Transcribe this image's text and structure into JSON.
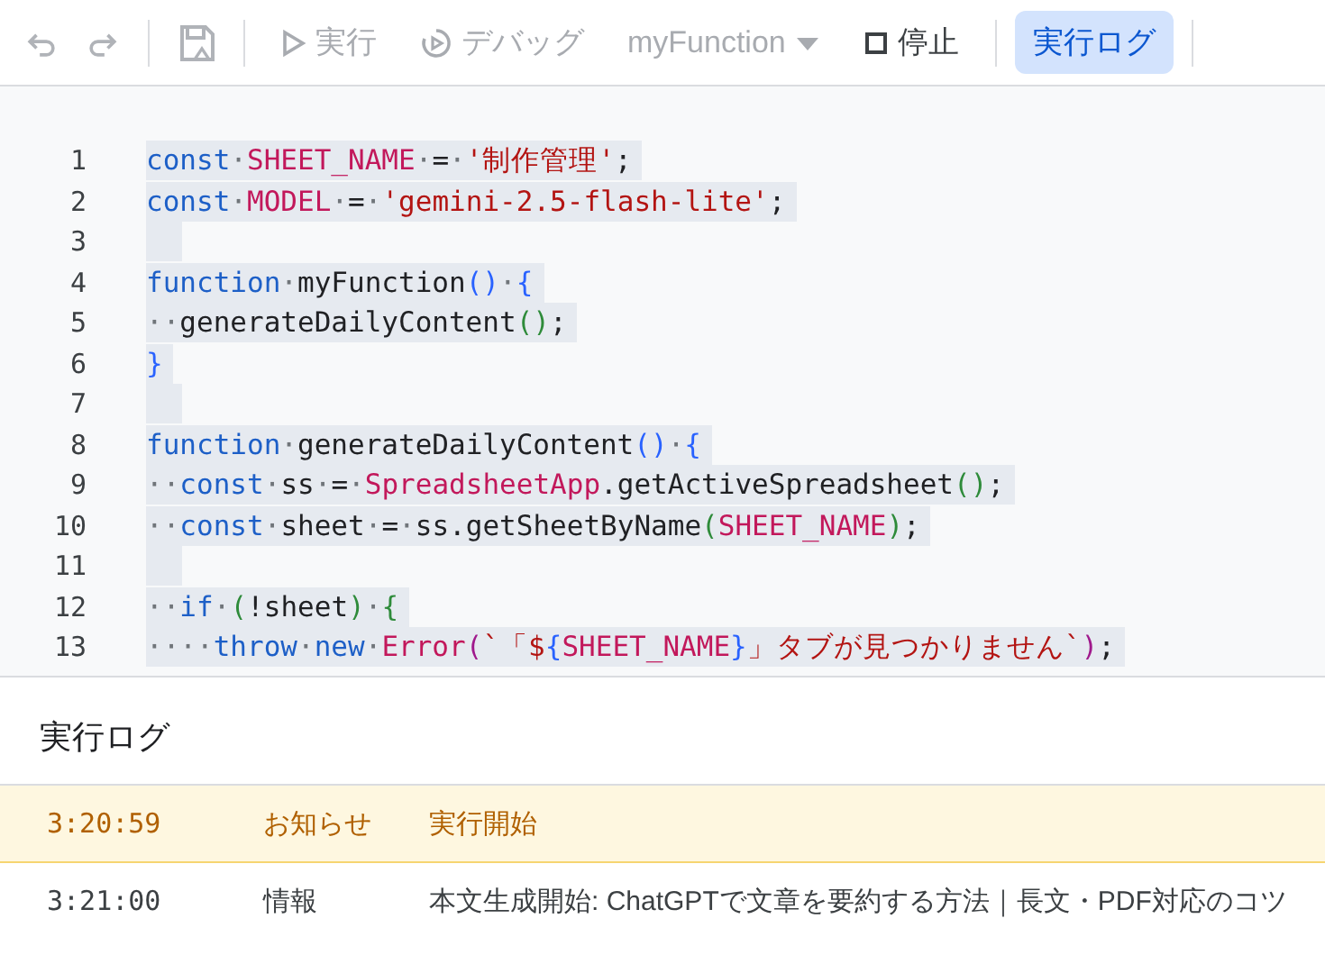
{
  "toolbar": {
    "items": [
      {
        "kind": "undo",
        "disabled": true
      },
      {
        "kind": "redo",
        "disabled": true
      },
      {
        "kind": "save",
        "disabled": true
      },
      {
        "kind": "run",
        "label": "実行",
        "disabled": true
      },
      {
        "kind": "debug",
        "label": "デバッグ",
        "disabled": true
      },
      {
        "kind": "dropdown",
        "label": "myFunction",
        "disabled": true
      },
      {
        "kind": "stop",
        "label": "停止",
        "disabled": false
      },
      {
        "kind": "toggle",
        "label": "実行ログ",
        "selected": true
      }
    ]
  },
  "editor": {
    "lines": [
      {
        "number": "1",
        "tokens": [
          {
            "text": "const",
            "kind": "kw"
          },
          {
            "text": "·",
            "kind": "ws"
          },
          {
            "text": "SHEET_NAME",
            "kind": "const"
          },
          {
            "text": "·",
            "kind": "ws"
          },
          {
            "text": "="
          },
          {
            "text": "·",
            "kind": "ws"
          },
          {
            "text": "'制作管理'",
            "kind": "str"
          },
          {
            "text": ";"
          }
        ]
      },
      {
        "number": "2",
        "tokens": [
          {
            "text": "const",
            "kind": "kw"
          },
          {
            "text": "·",
            "kind": "ws"
          },
          {
            "text": "MODEL",
            "kind": "const"
          },
          {
            "text": "·",
            "kind": "ws"
          },
          {
            "text": "="
          },
          {
            "text": "·",
            "kind": "ws"
          },
          {
            "text": "'gemini-2.5-flash-lite'",
            "kind": "str"
          },
          {
            "text": ";"
          }
        ]
      },
      {
        "number": "3"
      },
      {
        "number": "4",
        "tokens": [
          {
            "text": "function",
            "kind": "kw"
          },
          {
            "text": "·",
            "kind": "ws"
          },
          {
            "text": "myFunction"
          },
          {
            "text": "()",
            "kind": "b1"
          },
          {
            "text": "·",
            "kind": "ws"
          },
          {
            "text": "{",
            "kind": "b1"
          }
        ]
      },
      {
        "number": "5",
        "tokens": [
          {
            "text": "··",
            "kind": "ws"
          },
          {
            "text": "generateDailyContent"
          },
          {
            "text": "()",
            "kind": "b2"
          },
          {
            "text": ";"
          }
        ]
      },
      {
        "number": "6",
        "tokens": [
          {
            "text": "}",
            "kind": "b1"
          }
        ]
      },
      {
        "number": "7"
      },
      {
        "number": "8",
        "tokens": [
          {
            "text": "function",
            "kind": "kw"
          },
          {
            "text": "·",
            "kind": "ws"
          },
          {
            "text": "generateDailyContent"
          },
          {
            "text": "()",
            "kind": "b1"
          },
          {
            "text": "·",
            "kind": "ws"
          },
          {
            "text": "{",
            "kind": "b1"
          }
        ]
      },
      {
        "number": "9",
        "tokens": [
          {
            "text": "··",
            "kind": "ws"
          },
          {
            "text": "const",
            "kind": "kw"
          },
          {
            "text": "·",
            "kind": "ws"
          },
          {
            "text": "ss"
          },
          {
            "text": "·",
            "kind": "ws"
          },
          {
            "text": "="
          },
          {
            "text": "·",
            "kind": "ws"
          },
          {
            "text": "SpreadsheetApp",
            "kind": "const"
          },
          {
            "text": ".getActiveSpreadsheet"
          },
          {
            "text": "()",
            "kind": "b2"
          },
          {
            "text": ";"
          }
        ]
      },
      {
        "number": "10",
        "tokens": [
          {
            "text": "··",
            "kind": "ws"
          },
          {
            "text": "const",
            "kind": "kw"
          },
          {
            "text": "·",
            "kind": "ws"
          },
          {
            "text": "sheet"
          },
          {
            "text": "·",
            "kind": "ws"
          },
          {
            "text": "="
          },
          {
            "text": "·",
            "kind": "ws"
          },
          {
            "text": "ss.getSheetByName"
          },
          {
            "text": "(",
            "kind": "b2"
          },
          {
            "text": "SHEET_NAME",
            "kind": "const"
          },
          {
            "text": ")",
            "kind": "b2"
          },
          {
            "text": ";"
          }
        ]
      },
      {
        "number": "11"
      },
      {
        "number": "12",
        "tokens": [
          {
            "text": "··",
            "kind": "ws"
          },
          {
            "text": "if",
            "kind": "kw"
          },
          {
            "text": "·",
            "kind": "ws"
          },
          {
            "text": "(",
            "kind": "b2"
          },
          {
            "text": "!sheet"
          },
          {
            "text": ")",
            "kind": "b2"
          },
          {
            "text": "·",
            "kind": "ws"
          },
          {
            "text": "{",
            "kind": "b2"
          }
        ]
      },
      {
        "number": "13",
        "tokens": [
          {
            "text": "····",
            "kind": "ws"
          },
          {
            "text": "throw",
            "kind": "kw"
          },
          {
            "text": "·",
            "kind": "ws"
          },
          {
            "text": "new",
            "kind": "kw"
          },
          {
            "text": "·",
            "kind": "ws"
          },
          {
            "text": "Error",
            "kind": "const"
          },
          {
            "text": "(",
            "kind": "b3"
          },
          {
            "text": "`「$",
            "kind": "str"
          },
          {
            "text": "{",
            "kind": "b1"
          },
          {
            "text": "SHEET_NAME",
            "kind": "const"
          },
          {
            "text": "}",
            "kind": "b1"
          },
          {
            "text": "」タブが見つかりません`",
            "kind": "str"
          },
          {
            "text": ")",
            "kind": "b3"
          },
          {
            "text": ";"
          }
        ]
      }
    ]
  },
  "log": {
    "title": "実行ログ",
    "rows": [
      {
        "kind": "notice",
        "time": "3:20:59",
        "level": "お知らせ",
        "message": "実行開始"
      },
      {
        "kind": "info",
        "time": "3:21:00",
        "level": "情報",
        "message": "本文生成開始: ChatGPTで文章を要約する方法｜長文・PDF対応のコツ"
      }
    ]
  }
}
